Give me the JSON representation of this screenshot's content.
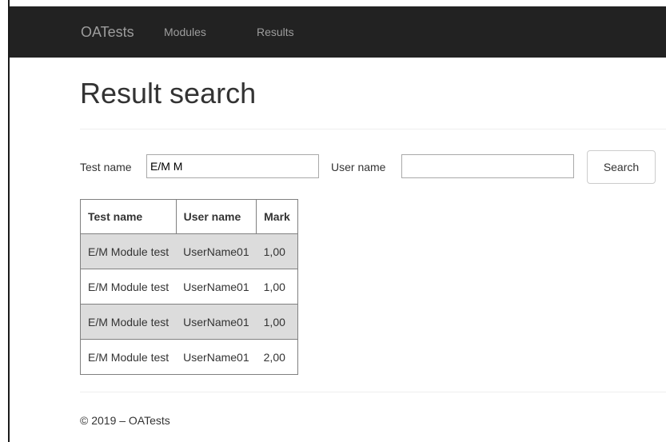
{
  "navbar": {
    "brand": "OATests",
    "links": [
      {
        "label": "Modules"
      },
      {
        "label": "Results"
      }
    ]
  },
  "page": {
    "title": "Result search"
  },
  "form": {
    "test_name_label": "Test name",
    "test_name_value": "E/M M",
    "user_name_label": "User name",
    "user_name_value": "",
    "search_label": "Search"
  },
  "table": {
    "headers": [
      "Test name",
      "User name",
      "Mark"
    ],
    "rows": [
      {
        "test_name": "E/M Module test",
        "user_name": "UserName01",
        "mark": "1,00"
      },
      {
        "test_name": "E/M Module test",
        "user_name": "UserName01",
        "mark": "1,00"
      },
      {
        "test_name": "E/M Module test",
        "user_name": "UserName01",
        "mark": "1,00"
      },
      {
        "test_name": "E/M Module test",
        "user_name": "UserName01",
        "mark": "2,00"
      }
    ]
  },
  "footer": {
    "text": "© 2019 – OATests"
  },
  "colors": {
    "navbar_bg": "#222222",
    "navbar_text": "#9d9d9d",
    "shaded_row": "#dcdcdc"
  }
}
